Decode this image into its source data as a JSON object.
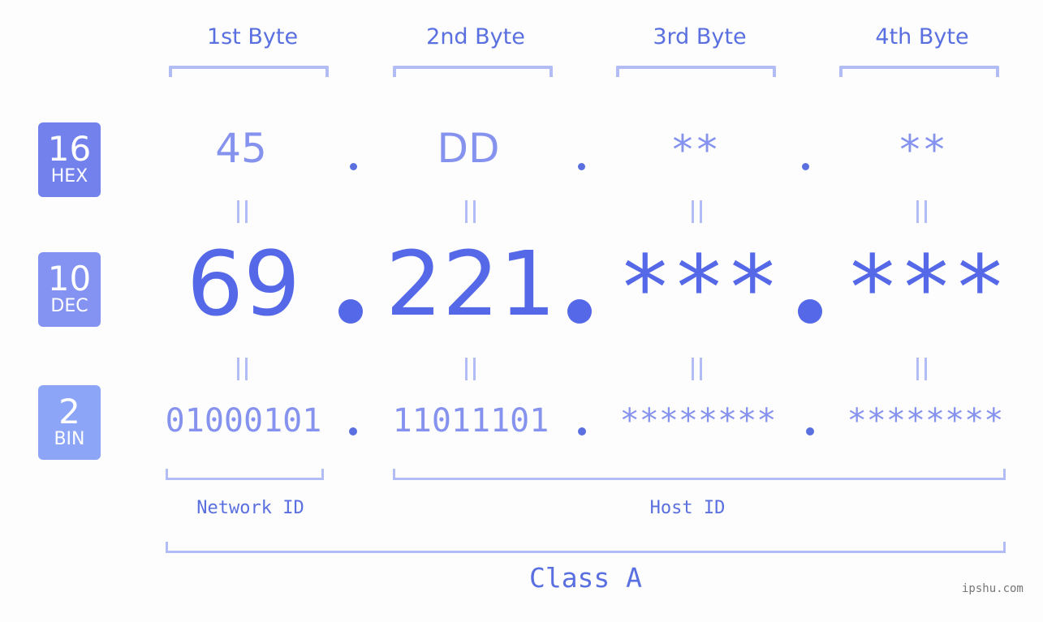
{
  "headers": {
    "bytes": [
      "1st Byte",
      "2nd Byte",
      "3rd Byte",
      "4th Byte"
    ]
  },
  "badges": {
    "hex": {
      "number": "16",
      "label": "HEX"
    },
    "dec": {
      "number": "10",
      "label": "DEC"
    },
    "bin": {
      "number": "2",
      "label": "BIN"
    }
  },
  "hex": [
    "45",
    "DD",
    "**",
    "**"
  ],
  "dec": [
    "69",
    "221",
    "***",
    "***"
  ],
  "bin": [
    "01000101",
    "11011101",
    "********",
    "********"
  ],
  "labels": {
    "network_id": "Network ID",
    "host_id": "Host ID",
    "class": "Class A"
  },
  "colors": {
    "accent": "#5568e8",
    "light_accent": "#8592ee",
    "bracket": "#b2bcf5",
    "hex_badge": "#7381ec",
    "dec_badge": "#8493f1",
    "bin_badge": "#8ca5f7"
  },
  "watermark": "ipshu.com"
}
